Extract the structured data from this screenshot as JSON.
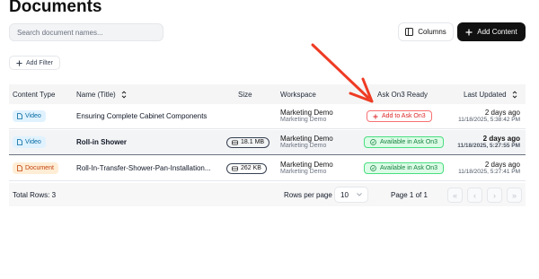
{
  "page": {
    "title": "Documents"
  },
  "search": {
    "placeholder": "Search document names..."
  },
  "toolbar": {
    "columns_label": "Columns",
    "add_content_label": "Add Content",
    "add_filter_label": "Add Filter"
  },
  "table": {
    "headers": {
      "content_type": "Content Type",
      "name": "Name (Title)",
      "size": "Size",
      "workspace": "Workspace",
      "ask": "Ask On3 Ready",
      "updated": "Last Updated"
    },
    "rows": [
      {
        "type": "Video",
        "name": "Ensuring Complete Cabinet Components",
        "size": "",
        "workspace": "Marketing Demo",
        "workspace_sub": "Marketing Demo",
        "ask": "Add to Ask On3",
        "updated_ago": "2 days ago",
        "updated_date": "11/18/2025, 5:38:42 PM"
      },
      {
        "type": "Video",
        "name": "Roll-in Shower",
        "size": "18.1 MB",
        "workspace": "Marketing Demo",
        "workspace_sub": "Marketing Demo",
        "ask": "Available in Ask On3",
        "updated_ago": "2 days ago",
        "updated_date": "11/18/2025, 5:27:55 PM"
      },
      {
        "type": "Document",
        "name": "Roll-In-Transfer-Shower-Pan-Installation...",
        "size": "262 KB",
        "workspace": "Marketing Demo",
        "workspace_sub": "Marketing Demo",
        "ask": "Available in Ask On3",
        "updated_ago": "2 days ago",
        "updated_date": "11/18/2025, 5:27:41 PM"
      }
    ]
  },
  "footer": {
    "total_rows": "Total Rows: 3",
    "rows_per_page_label": "Rows per page",
    "rows_per_page_value": "10",
    "page_info": "Page 1 of 1"
  },
  "colors": {
    "primary": "#111111",
    "add_red": "#dc2626",
    "ok_green": "#15803d",
    "video_blue": "#0369a1",
    "doc_orange": "#c2410c"
  }
}
